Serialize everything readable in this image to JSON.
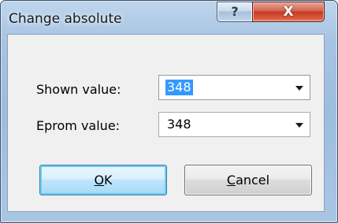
{
  "window": {
    "title": "Change absolute",
    "help_glyph": "?",
    "close_glyph": "X"
  },
  "form": {
    "shown_label": "Shown value:",
    "shown_value": "348",
    "eprom_label": "Eprom value:",
    "eprom_value": "348"
  },
  "buttons": {
    "ok_mnemonic": "O",
    "ok_rest": "K",
    "cancel_mnemonic": "C",
    "cancel_rest": "ancel"
  },
  "colors": {
    "selection": "#3399ff",
    "close_button": "#c23d24",
    "frame": "#a9c6e4"
  },
  "icons": [
    "help-icon",
    "close-icon",
    "dropdown-arrow-icon"
  ]
}
